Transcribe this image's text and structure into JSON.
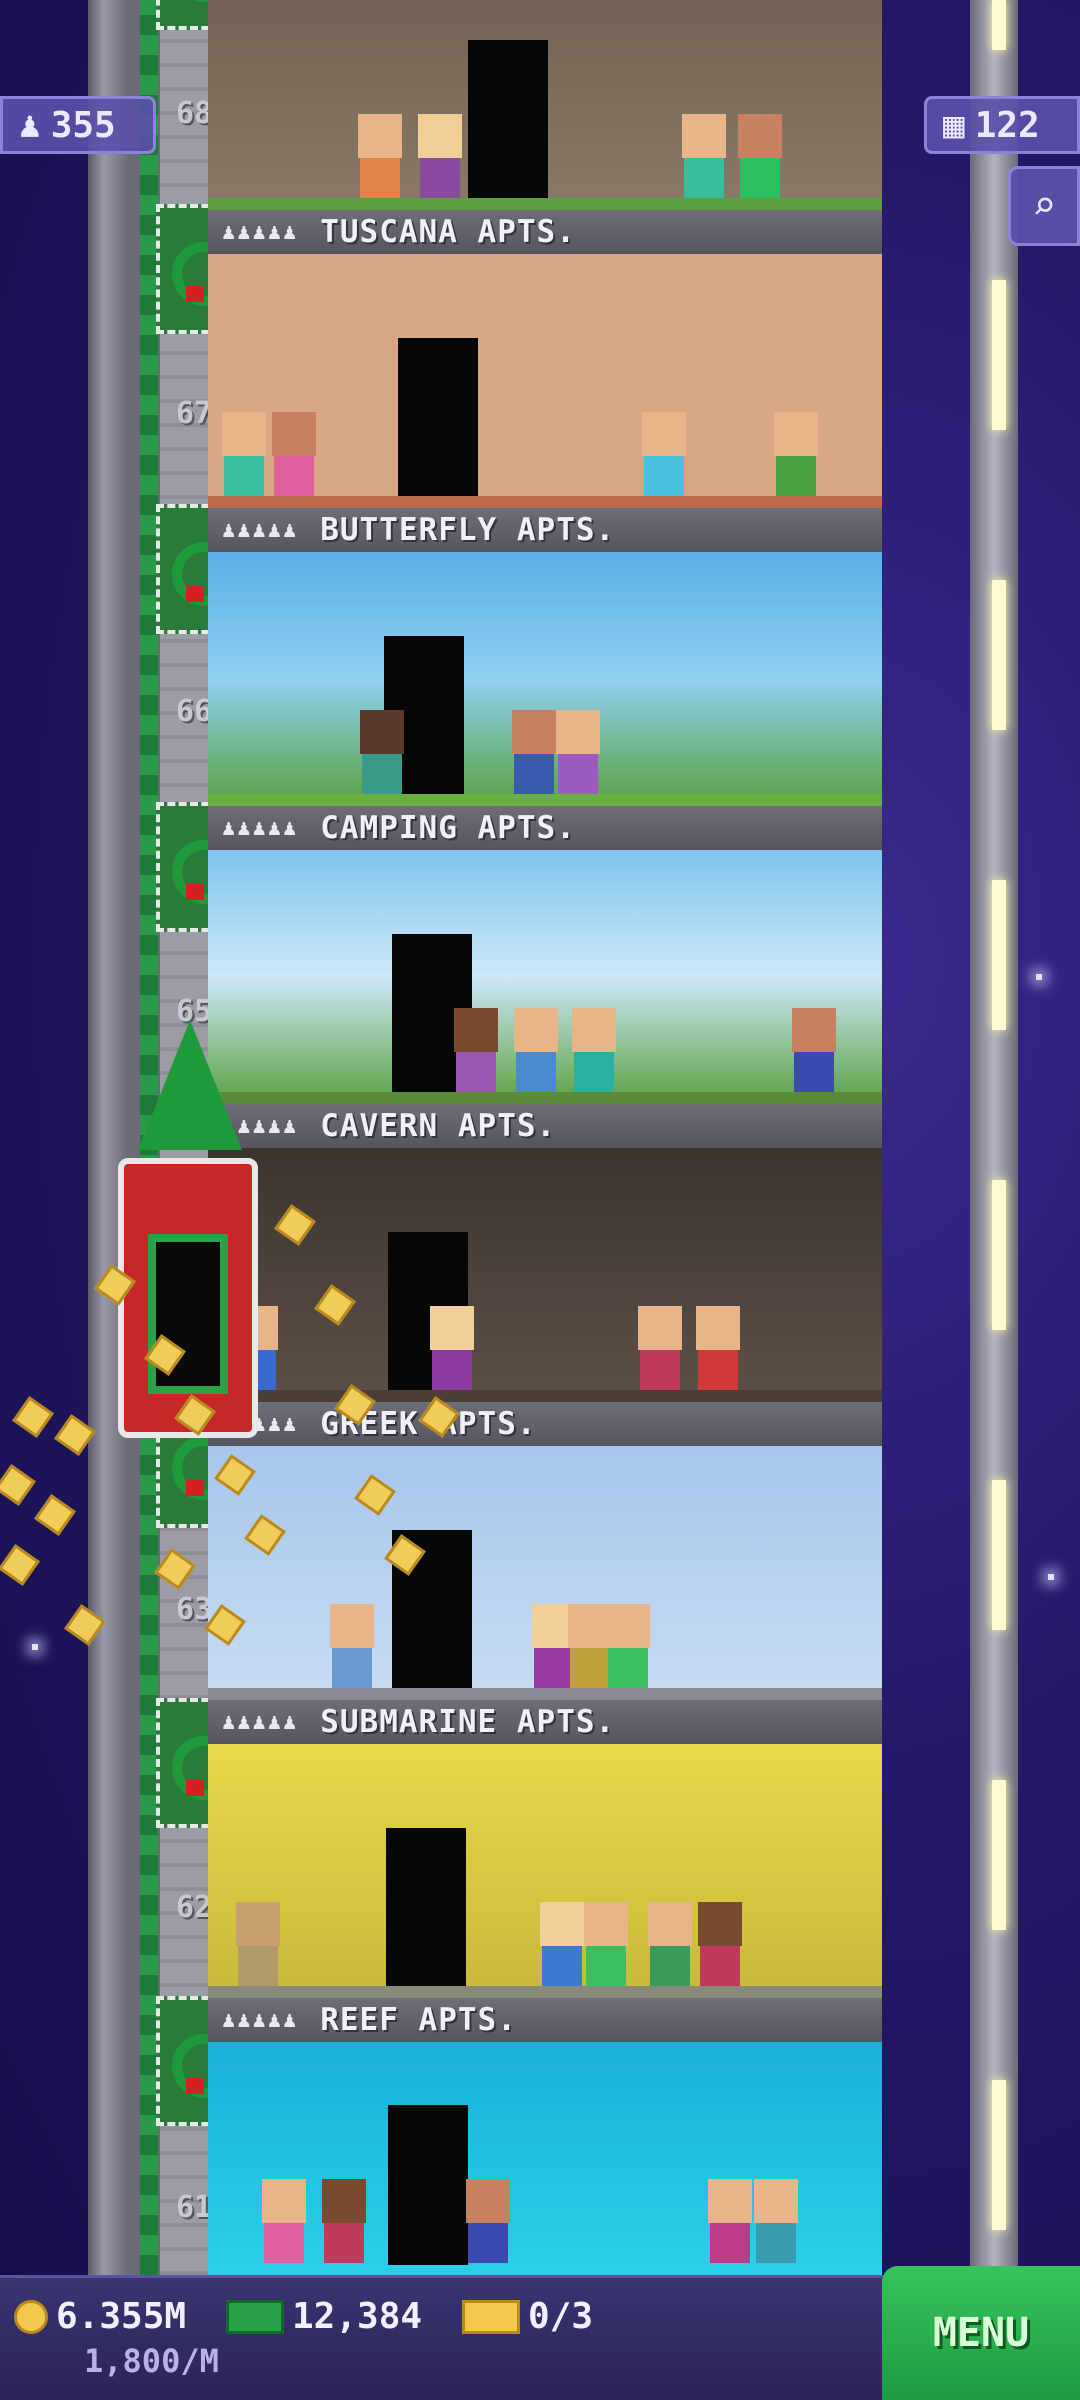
{
  "top_bar": {
    "population": "355",
    "floors": "122"
  },
  "elevator_floor_numbers": [
    "68",
    "67",
    "66",
    "65",
    "63",
    "62",
    "61"
  ],
  "floors": [
    {
      "name": "TUSCANA APTS.",
      "people": "♟♟♟♟♟"
    },
    {
      "name": "BUTTERFLY APTS.",
      "people": "♟♟♟♟♟"
    },
    {
      "name": "CAMPING APTS.",
      "people": "♟♟♟♟♟"
    },
    {
      "name": "CAVERN APTS.",
      "people": "♟♟♟♟♟"
    },
    {
      "name": "GREEK APTS.",
      "people": "♟♟♟♟♟"
    },
    {
      "name": "SUBMARINE APTS.",
      "people": "♟♟♟♟♟"
    },
    {
      "name": "REEF APTS.",
      "people": "♟♟♟♟♟"
    }
  ],
  "bottom_bar": {
    "coins": "6.355M",
    "bux": "12,384",
    "tickets": "0/3",
    "rate": "1,800/M",
    "menu_label": "MENU"
  },
  "icons": {
    "population": "person-icon",
    "floors": "building-icon",
    "search": "magnifier-icon",
    "coins": "coin-icon",
    "bux": "bux-icon",
    "tickets": "golden-ticket-icon"
  }
}
